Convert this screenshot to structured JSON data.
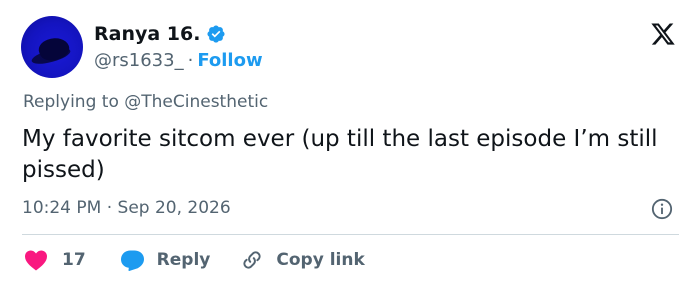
{
  "author": {
    "display_name": "Ranya 16.",
    "handle": "@rs1633_",
    "separator": "·",
    "follow_label": "Follow",
    "verified_color": "#1d9bf0"
  },
  "tweet": {
    "replying_prefix": "Replying to",
    "replying_to": "@TheCinesthetic",
    "text": "My favorite sitcom ever (up till the last episode I’m still pissed)",
    "timestamp": "10:24 PM · Sep 20, 2026"
  },
  "actions": {
    "likes": "17",
    "reply_label": "Reply",
    "copy_link_label": "Copy link"
  },
  "colors": {
    "accent": "#1d9bf0",
    "like": "#f91880",
    "text_secondary": "#536471",
    "text_primary": "#0f1419"
  },
  "icons": [
    "x-logo-icon",
    "verified-badge-icon",
    "info-icon",
    "heart-icon",
    "reply-bubble-icon",
    "link-icon"
  ]
}
